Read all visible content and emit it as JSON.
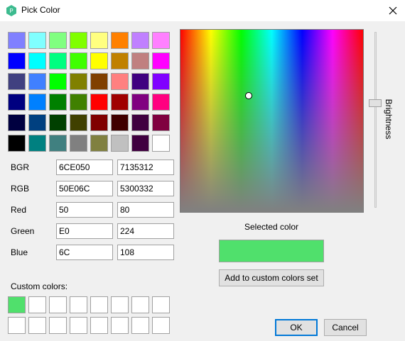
{
  "window": {
    "title": "Pick Color",
    "app_icon": "app-logo-icon",
    "close_icon": "close-icon"
  },
  "basic_colors": [
    "#8080ff",
    "#80ffff",
    "#80ff80",
    "#80ff00",
    "#ffff80",
    "#ff8000",
    "#c080ff",
    "#ff80ff",
    "#0000ff",
    "#00ffff",
    "#00ff80",
    "#40ff00",
    "#ffff00",
    "#c08000",
    "#c08080",
    "#ff00ff",
    "#404080",
    "#4080ff",
    "#00ff00",
    "#808000",
    "#804000",
    "#ff8080",
    "#400080",
    "#8000ff",
    "#000080",
    "#0080ff",
    "#008000",
    "#408000",
    "#ff0000",
    "#a00000",
    "#800080",
    "#ff0080",
    "#000040",
    "#004080",
    "#004000",
    "#404000",
    "#800000",
    "#400000",
    "#400040",
    "#800040",
    "#000000",
    "#008080",
    "#408080",
    "#808080",
    "#808040",
    "#c0c0c0",
    "#400040",
    "#ffffff"
  ],
  "fields": {
    "bgr": {
      "label": "BGR",
      "hex": "6CE050",
      "dec": "7135312"
    },
    "rgb": {
      "label": "RGB",
      "hex": "50E06C",
      "dec": "5300332"
    },
    "red": {
      "label": "Red",
      "hex": "50",
      "dec": "80"
    },
    "green": {
      "label": "Green",
      "hex": "E0",
      "dec": "224"
    },
    "blue": {
      "label": "Blue",
      "hex": "6C",
      "dec": "108"
    }
  },
  "brightness_label": "Brightness",
  "brightness_level": 0.6,
  "selected": {
    "label": "Selected color",
    "color": "#50e06c"
  },
  "buttons": {
    "add_custom": "Add to custom colors set",
    "ok": "OK",
    "cancel": "Cancel"
  },
  "custom": {
    "label": "Custom colors:",
    "colors": [
      "#50e06c",
      "#ffffff",
      "#ffffff",
      "#ffffff",
      "#ffffff",
      "#ffffff",
      "#ffffff",
      "#ffffff",
      "#ffffff",
      "#ffffff",
      "#ffffff",
      "#ffffff",
      "#ffffff",
      "#ffffff",
      "#ffffff",
      "#ffffff"
    ]
  }
}
